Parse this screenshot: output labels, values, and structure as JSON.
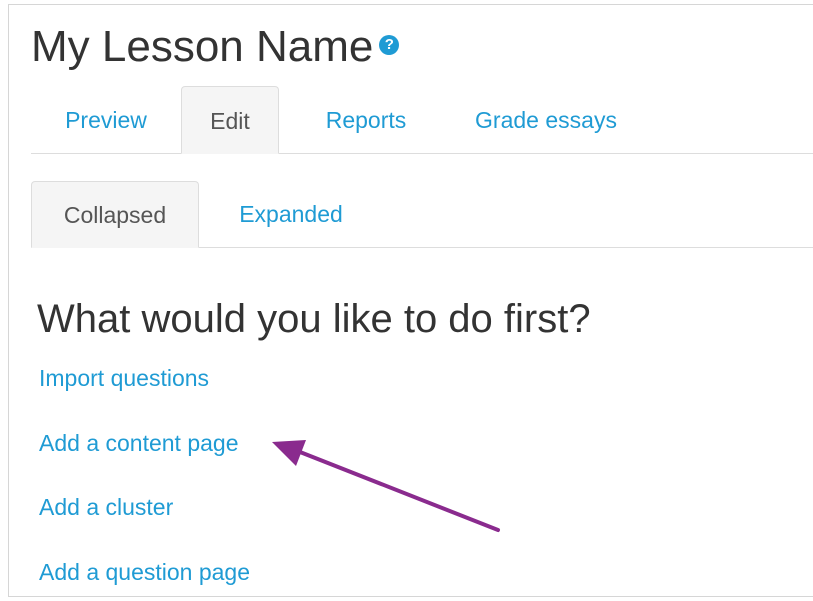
{
  "page": {
    "title": "My Lesson Name",
    "help_icon": "question-circle-icon"
  },
  "primary_tabs": [
    {
      "label": "Preview",
      "active": false
    },
    {
      "label": "Edit",
      "active": true
    },
    {
      "label": "Reports",
      "active": false
    },
    {
      "label": "Grade essays",
      "active": false
    }
  ],
  "view_tabs": [
    {
      "label": "Collapsed",
      "active": true
    },
    {
      "label": "Expanded",
      "active": false
    }
  ],
  "main": {
    "heading": "What would you like to do first?",
    "actions": [
      {
        "label": "Import questions"
      },
      {
        "label": "Add a content page"
      },
      {
        "label": "Add a cluster"
      },
      {
        "label": "Add a question page"
      }
    ]
  },
  "colors": {
    "link": "#1f9bd4",
    "text": "#333333",
    "annotation_arrow": "#8a2b8e"
  }
}
